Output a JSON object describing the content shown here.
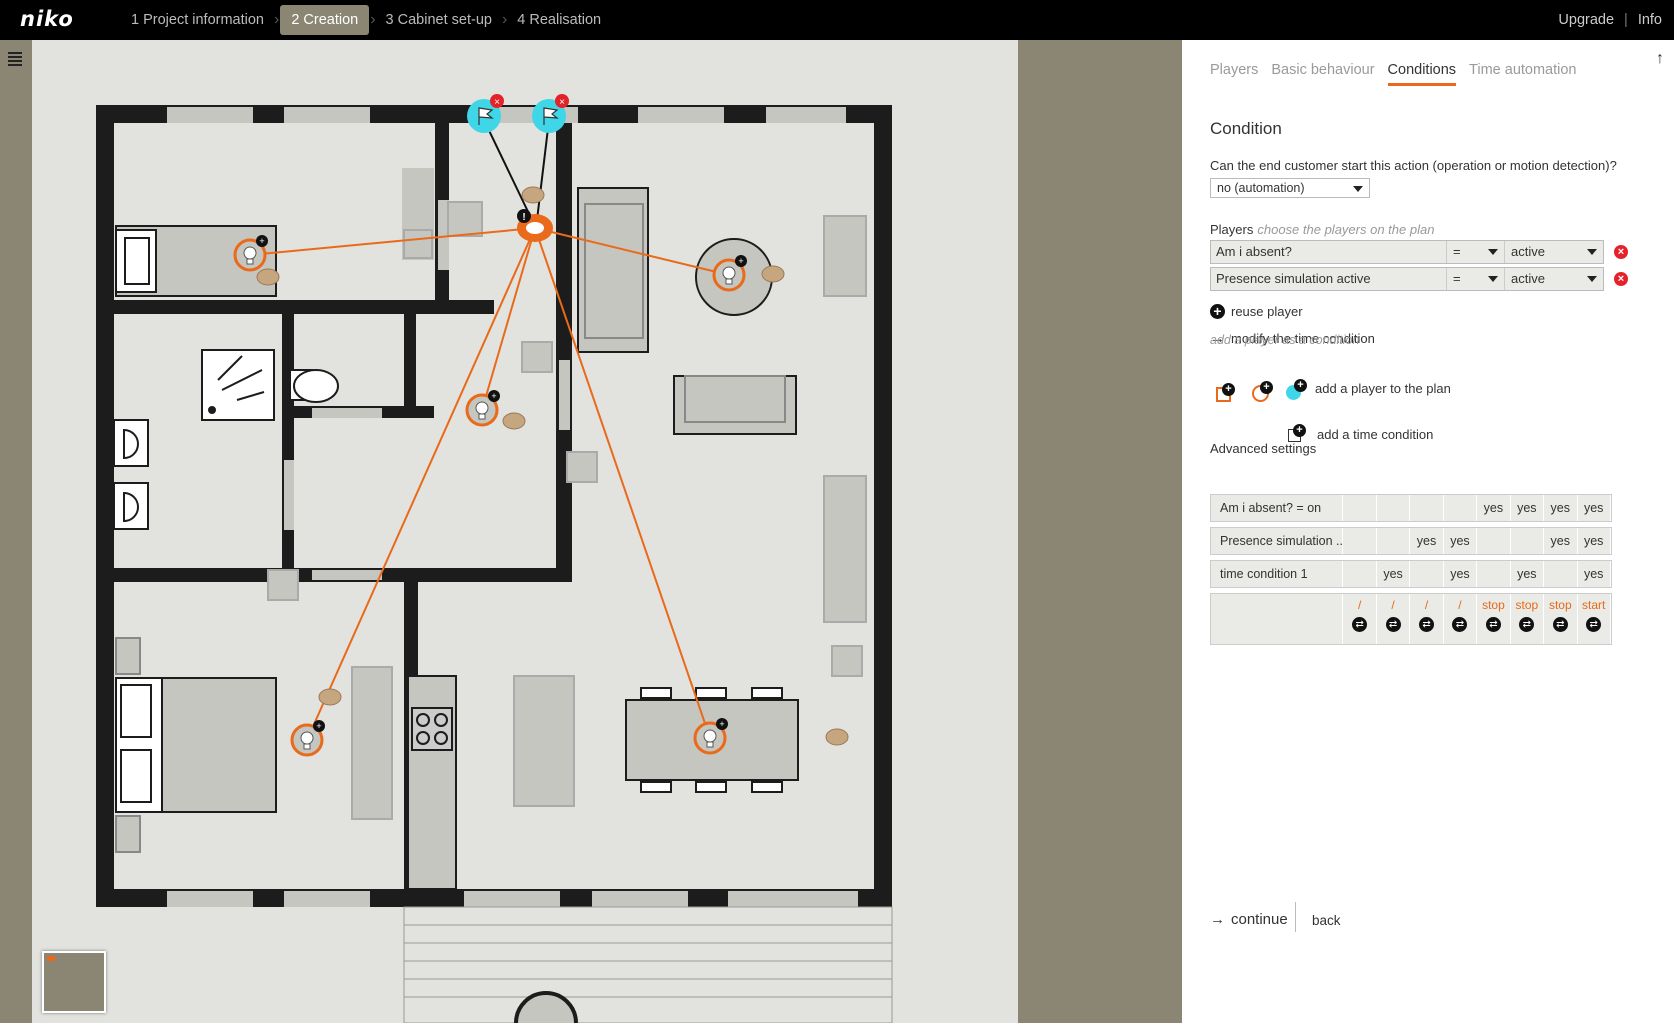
{
  "header": {
    "logo": "niko",
    "steps": [
      "1 Project information",
      "2 Creation",
      "3 Cabinet set-up",
      "4 Realisation"
    ],
    "active_step": 1,
    "upgrade": "Upgrade",
    "info": "Info"
  },
  "panel": {
    "tabs": [
      "Players",
      "Basic behaviour",
      "Conditions",
      "Time automation"
    ],
    "active_tab": 2,
    "heading": "Condition",
    "question": "Can the end customer start this action (operation or motion detection)?",
    "start_mode": "no (automation)",
    "players_label": "Players",
    "players_hint": "choose the players on the plan",
    "players": [
      {
        "name": "Am i absent?",
        "operator": "=",
        "value": "active"
      },
      {
        "name": "Presence simulation active",
        "operator": "=",
        "value": "active"
      }
    ],
    "reuse_player": "reuse player",
    "modify_time": "modify the time condition",
    "add_as_condition": "add a player as a condition",
    "add_player_plan": "add a player to the plan",
    "add_time_condition": "add a time condition",
    "advanced_label": "Advanced settings",
    "advanced_rows": [
      {
        "label": "Am i absent? = on",
        "cells": [
          "",
          "",
          "",
          "",
          "yes",
          "yes",
          "yes",
          "yes"
        ]
      },
      {
        "label": "Presence simulation ...",
        "cells": [
          "",
          "",
          "yes",
          "yes",
          "",
          "",
          "yes",
          "yes"
        ]
      },
      {
        "label": "time condition 1",
        "cells": [
          "",
          "yes",
          "",
          "yes",
          "",
          "yes",
          "",
          "yes"
        ]
      }
    ],
    "actions": [
      "/",
      "/",
      "/",
      "/",
      "stop",
      "stop",
      "stop",
      "start"
    ],
    "continue": "continue",
    "back": "back"
  },
  "colors": {
    "accent": "#e86a1a",
    "flag": "#3fd6e8",
    "wall": "#1c1c1c",
    "room": "#e2e2de",
    "furniture": "#c6c6c0"
  }
}
